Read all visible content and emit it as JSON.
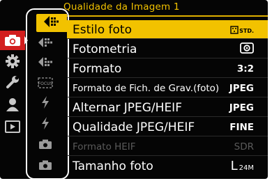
{
  "header": {
    "title": "Qualidade da Imagem 1"
  },
  "colors": {
    "accent": "#f2c200",
    "active_category": "#d21e1e",
    "text": "#ffffff",
    "disabled": "#5a5a5a"
  },
  "categories": [
    {
      "icon": "camera-icon",
      "active": true
    },
    {
      "icon": "gear-icon",
      "active": false
    },
    {
      "icon": "wrench-icon",
      "active": false
    },
    {
      "icon": "user-icon",
      "active": false
    },
    {
      "icon": "playback-icon",
      "active": false
    }
  ],
  "tabs": [
    {
      "icon": "image-quality-1-icon",
      "selected": true
    },
    {
      "icon": "image-quality-2-icon",
      "selected": false
    },
    {
      "icon": "image-quality-3-icon",
      "selected": false
    },
    {
      "icon": "focus-icon",
      "label": "FOCUS",
      "selected": false
    },
    {
      "icon": "flash-1-icon",
      "selected": false
    },
    {
      "icon": "flash-2-icon",
      "selected": false
    },
    {
      "icon": "camera-1-icon",
      "selected": false
    },
    {
      "icon": "camera-2-icon",
      "selected": false
    }
  ],
  "menu": {
    "items": [
      {
        "label": "Estilo foto",
        "value": "STD.",
        "value_icon": "photo-style-icon",
        "selected": true,
        "disabled": false
      },
      {
        "label": "Fotometria",
        "value": "",
        "value_icon": "metering-icon",
        "selected": false,
        "disabled": false
      },
      {
        "label": "Formato",
        "value": "3:2",
        "selected": false,
        "disabled": false
      },
      {
        "label": "Formato de Fich. de Grav.(foto)",
        "value": "JPEG",
        "selected": false,
        "disabled": false
      },
      {
        "label": "Alternar JPEG/HEIF",
        "value": "JPEG",
        "selected": false,
        "disabled": false
      },
      {
        "label": "Qualidade JPEG/HEIF",
        "value": "FINE",
        "selected": false,
        "disabled": false
      },
      {
        "label": "Formato HEIF",
        "value": "SDR",
        "selected": false,
        "disabled": true
      },
      {
        "label": "Tamanho foto",
        "value": "L",
        "value_suffix": "24M",
        "selected": false,
        "disabled": false
      }
    ]
  }
}
